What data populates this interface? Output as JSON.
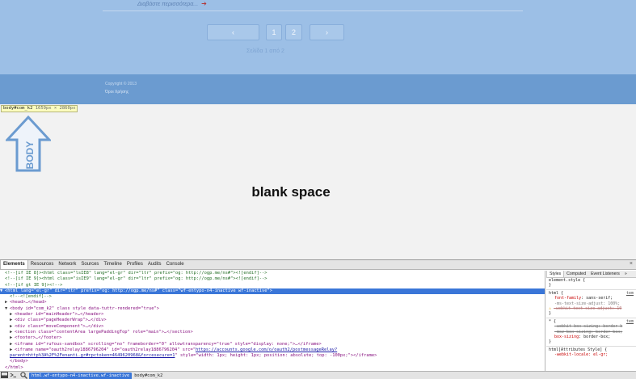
{
  "page": {
    "read_more": "Διαβάστε περισσότερα...",
    "read_more_arrow": "➔",
    "pagination": {
      "prev": "‹",
      "pages": [
        "1",
        "2"
      ],
      "next": "›"
    },
    "page_of": "Σελίδα 1 από 2",
    "copyright": "Copyright © 2013",
    "terms": "Όροι Χρήσης",
    "tooltip_tag": "body#com_k2",
    "tooltip_size": "1659px × 2860px",
    "body_label": "BODY",
    "blank_label": "blank space"
  },
  "colors": {
    "highlight_main": "#9cbfe6",
    "highlight_footer": "#6b9bd0",
    "selection": "#3a76d8"
  },
  "devtools": {
    "tabs": [
      "Elements",
      "Resources",
      "Network",
      "Sources",
      "Timeline",
      "Profiles",
      "Audits",
      "Console"
    ],
    "close_icon": "×",
    "dom": {
      "l0": "<!--[if IE 8]><html class=\"lsIE8\" lang=\"el-gr\" dir=\"ltr\" prefix=\"og: http://ogp.me/ns#\"><![endif]-->",
      "l1": "<!--[if IE 9]><html class=\"isIE9\" lang=\"el-gr\" dir=\"ltr\" prefix=\"og: http://ogp.me/ns#\"><![endif]-->",
      "l2": "<!--[if gt IE 9]><!-->",
      "l3": "<html lang=\"el-gr\" dir=\"ltr\" prefix=\"og: http://ogp.me/ns#\" class=\"wf-entypo-n4-inactive wf-inactive\">",
      "l4": "<!--<![endif]-->",
      "l5": "<head>…</head>",
      "l6": "<body id=\"com_k2\" class style data-tuttr-rendered=\"true\">",
      "l7": "<header id=\"mainHeader\">…</header>",
      "l8": "<div class=\"pageHeaderWrap\">…</div>",
      "l9": "<div class=\"moveComponent\">…</div>",
      "l10": "<section class=\"contentArea largePaddingTop\" role=\"main\">…</section>",
      "l11": "<footer>…</footer>",
      "l12": "<iframe id=\"rufous-sandbox\" scrolling=\"no\" frameborder=\"0\" allowtransparency=\"true\" style=\"display: none;\">…</iframe>",
      "l13_a": "<iframe name=\"oauth2relay1886796204\" id=\"oauth2relay1886796204\" src=\"",
      "l13_link": "https://accounts.google.com/o/oauth2/postmessageRelay?",
      "l14_link": "parent=http%3A%2F%2Fenanti.gr#rpctoken=4649620968&forcesecure=1",
      "l14_b": "\" style=\"width: 1px; height: 1px; position: absolute; top: -100px;\"></iframe>",
      "l15": "</body>",
      "l16": "</html>"
    },
    "styles_tabs": [
      "Styles",
      "Computed",
      "Event Listeners",
      "»"
    ],
    "styles": {
      "element_style": "element.style {",
      "close": "}",
      "html_sel": "html {",
      "html_src": "tem",
      "html_p1_n": "font-family",
      "html_p1_v": ": sans-serif;",
      "html_p2": "-ms-text-size-adjust: 100%;",
      "html_p3": "-webkit-text-size-adjust: 10",
      "star_sel": "* {",
      "star_src": "tem",
      "star_p1": "-webkit-box-sizing: border-b",
      "star_p2": "-moz-box-sizing: border-box;",
      "star_p3_n": "box-sizing",
      "star_p3_v": ": border-box;",
      "attr_sel": "html[Attributes Style] {",
      "attr_p1": "-webkit-locale: el-gr;"
    },
    "status": {
      "breadcrumbs": [
        "html.wf-entypo-n4-inactive.wf-inactive",
        "body#com_k2"
      ],
      "icons": [
        "dock-icon",
        "console-icon",
        "search-icon"
      ]
    }
  }
}
